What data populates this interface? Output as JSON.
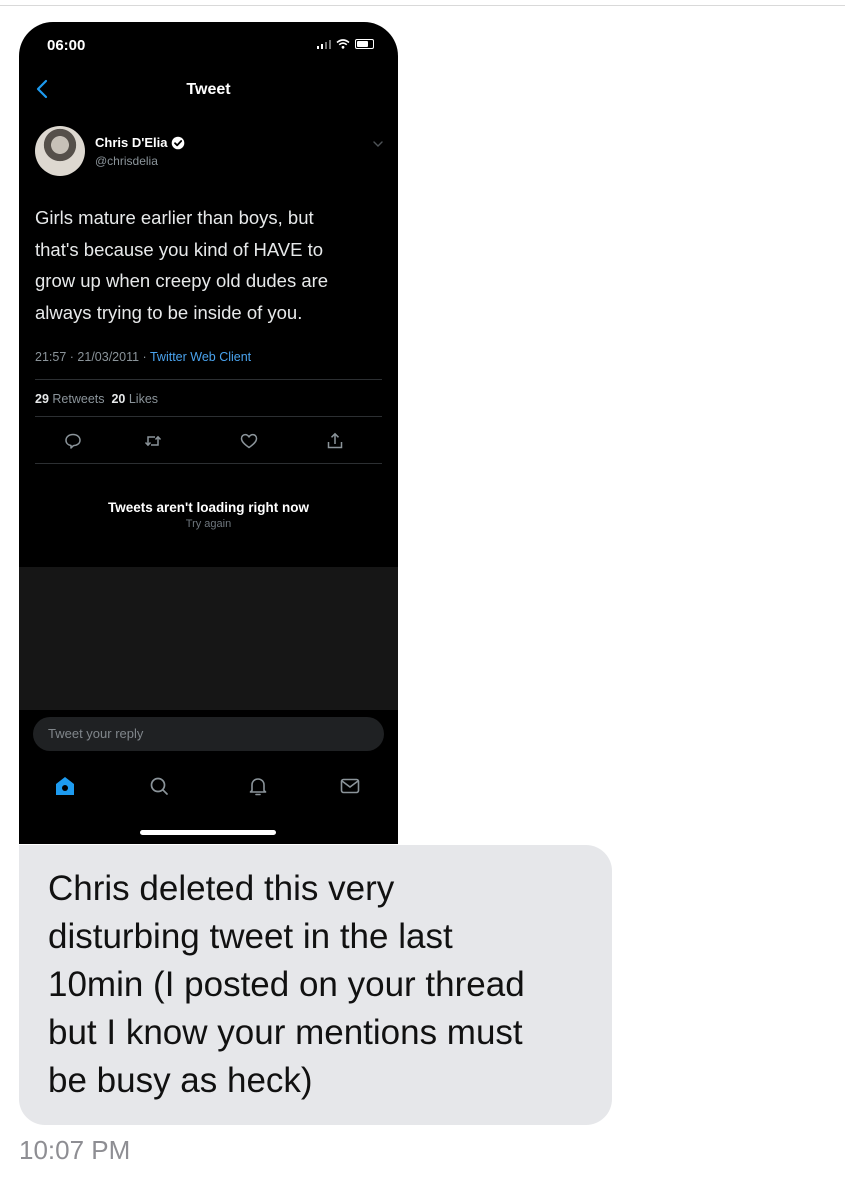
{
  "status_bar": {
    "time": "06:00"
  },
  "header": {
    "title": "Tweet"
  },
  "tweet": {
    "author_name": "Chris D'Elia",
    "handle": "@chrisdelia",
    "verified": true,
    "text_lines": [
      "Girls mature earlier than boys, but",
      "that's because you kind of HAVE to",
      "grow up when creepy old dudes are",
      "always trying to be inside of you."
    ],
    "time": "21:57",
    "date": "21/03/2011",
    "separator": "·",
    "source": "Twitter Web Client",
    "retweets_count": "29",
    "retweets_label": "Retweets",
    "likes_count": "20",
    "likes_label": "Likes"
  },
  "actions": [
    "reply-icon",
    "retweet-icon",
    "like-icon",
    "share-icon"
  ],
  "replies": {
    "message": "Tweets aren't loading right now",
    "retry": "Try again"
  },
  "reply_box": {
    "placeholder": "Tweet your reply"
  },
  "tabbar": [
    "home-icon",
    "search-icon",
    "notifications-icon",
    "messages-icon"
  ],
  "message": {
    "lines": [
      "Chris deleted this very",
      "disturbing tweet in the last",
      "10min (I posted on your thread",
      "but I know your mentions must",
      "be busy as heck)"
    ],
    "timestamp": "10:07 PM"
  },
  "colors": {
    "accent": "#1d9bf0",
    "link": "#4aa3ee",
    "bubble": "#e6e7ea",
    "timestamp": "#8e8e93"
  }
}
